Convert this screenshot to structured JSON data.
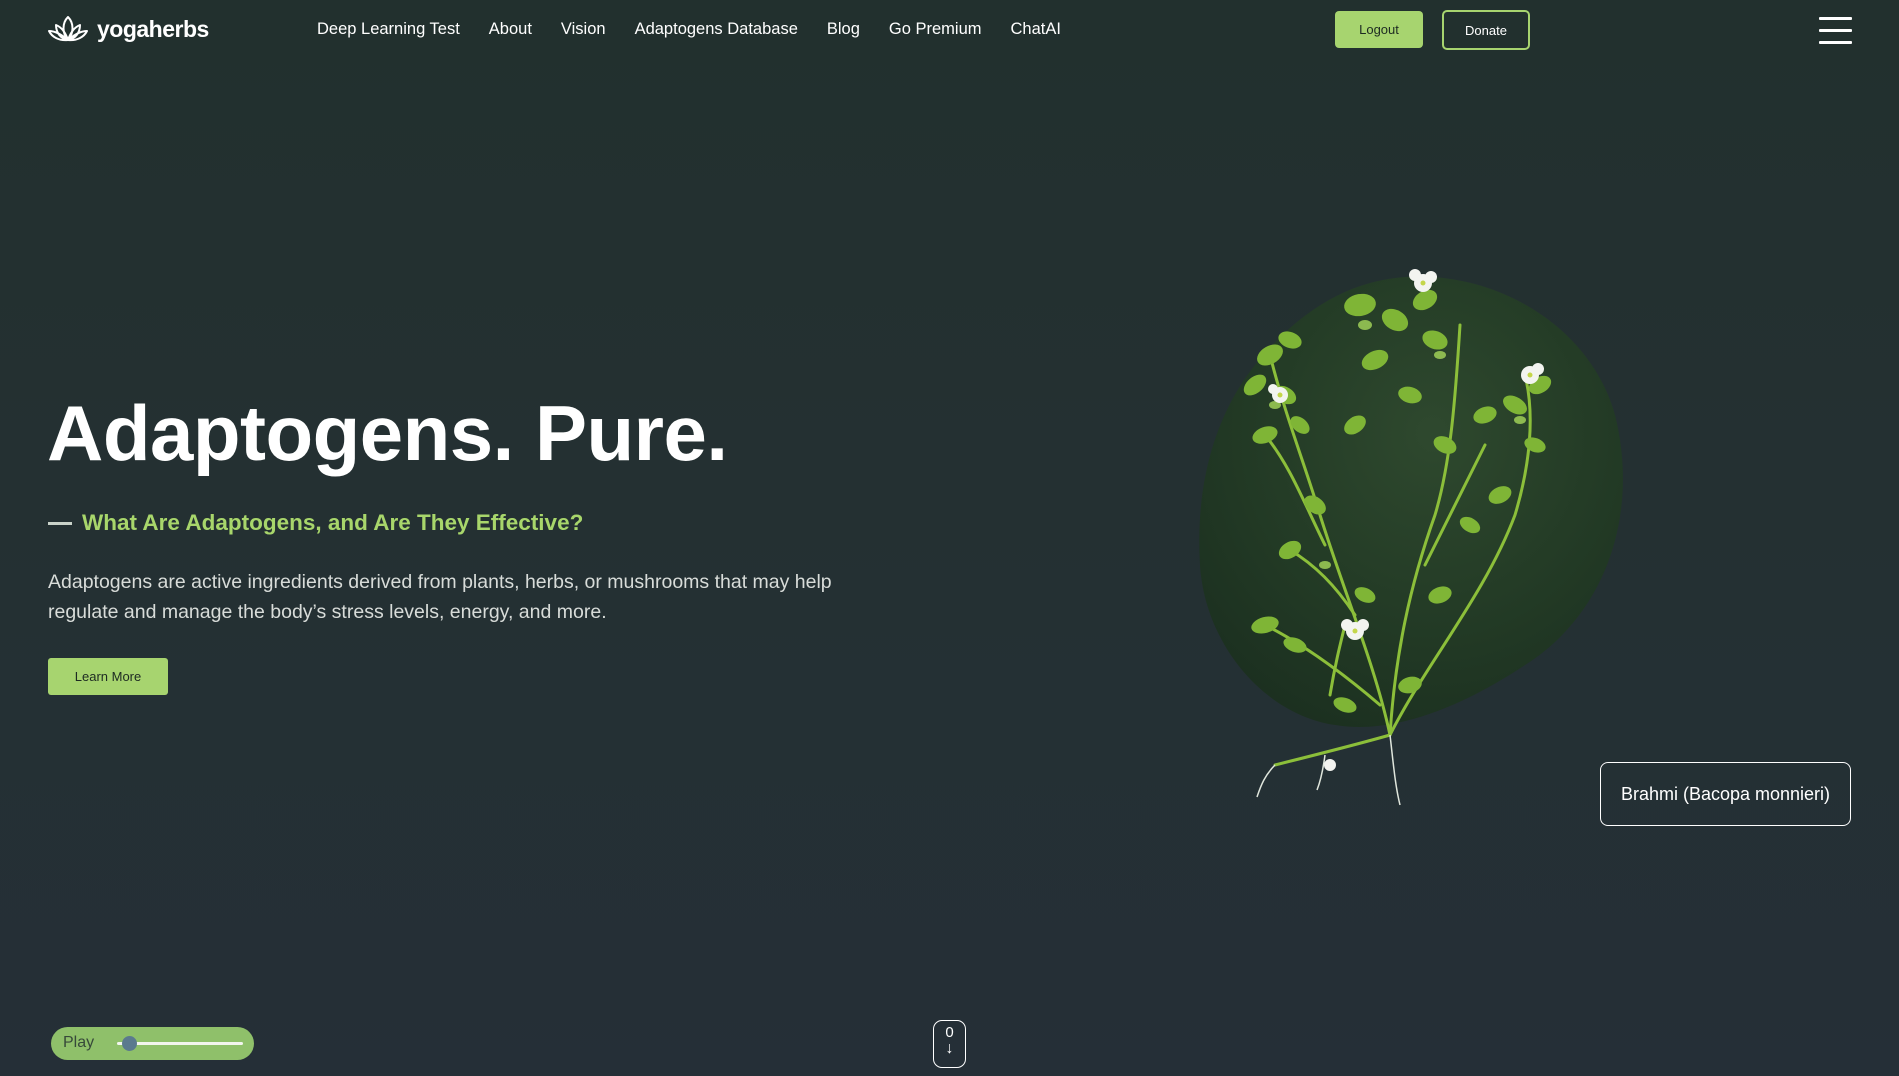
{
  "header": {
    "logo_text": "yogaherbs",
    "logo_icon": "lotus-icon",
    "nav": [
      {
        "label": "Deep Learning Test"
      },
      {
        "label": "About"
      },
      {
        "label": "Vision"
      },
      {
        "label": "Adaptogens Database"
      },
      {
        "label": "Blog"
      },
      {
        "label": "Go Premium"
      },
      {
        "label": "ChatAI"
      }
    ],
    "logout_label": "Logout",
    "donate_label": "Donate",
    "menu_icon": "hamburger-menu-icon"
  },
  "hero": {
    "title": "Adaptogens. Pure.",
    "subtitle": "What Are Adaptogens, and Are They Effective?",
    "description": "Adaptogens are active ingredients derived from plants, herbs, or mushrooms that may help regulate and manage the body’s stress levels, energy, and more.",
    "button_label": "Learn More"
  },
  "plant": {
    "label": "Brahmi (Bacopa monnieri)"
  },
  "player": {
    "play_label": "Play",
    "progress": 0.1
  },
  "scroll": {
    "count": "0",
    "arrow_icon": "arrow-down-icon"
  },
  "colors": {
    "accent": "#a7d46f",
    "subtitle": "#a8d66b",
    "background": "#22302e"
  }
}
